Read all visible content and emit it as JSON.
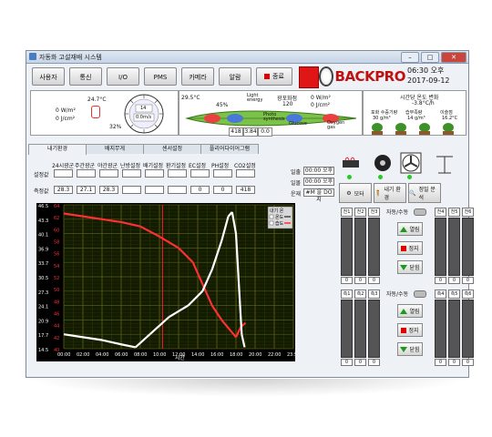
{
  "window": {
    "title": "자동화 고설재배 시스템"
  },
  "toolbar": {
    "buttons": [
      "사용자",
      "통신",
      "I/O",
      "PMS",
      "카메라",
      "알람"
    ],
    "end_label": "종료"
  },
  "logo": {
    "text": "BACKPRO"
  },
  "clock": {
    "time": "06:30 오후",
    "date": "2017-09-12"
  },
  "weather": {
    "temp": "24.7°C",
    "solar": "0 W/m²",
    "energy": "0 J/cm²",
    "wind_dir": "14",
    "wind_speed": "0.0m/s",
    "humidity": "32%"
  },
  "photo": {
    "temp": "29.5°C",
    "humidity": "45%",
    "light_label": "Light energy",
    "solar_label": "광포화점",
    "solar_value": "120",
    "solar_unit1": "0 W/m²",
    "solar_unit2": "0 J/cm²",
    "co2": "418",
    "vpd": "3.84",
    "extra": "0.0",
    "co2_unit": "ppm",
    "unit2": "Kg",
    "unit3": "°C",
    "photo_label": "Photo synthesis",
    "glucose": "Glucose",
    "oxygen": "Oxygen gas"
  },
  "plant": {
    "title": "시간당 온도 변화",
    "delta": "-3.8°C/h",
    "labels": [
      "포화 수증기량",
      "습부족량",
      "이슬점"
    ],
    "values": [
      "30 g/m³",
      "14 g/m³",
      "16.2°C"
    ]
  },
  "tabs": [
    "내기환경",
    "배지무게",
    "센서설정",
    "플리어다이어그램"
  ],
  "settings": {
    "headers": [
      "24시광군",
      "주간광군",
      "야간광군",
      "난방설정",
      "배기설정",
      "환기설정",
      "EC설정",
      "PH설정",
      "CO2설정"
    ],
    "row1_label": "설정값",
    "row2_label": "측정값",
    "measured": [
      "28.3",
      "27.1",
      "28.3",
      "",
      "",
      "",
      "0",
      "0",
      "418"
    ]
  },
  "day": {
    "labels": [
      "일출",
      "일몰",
      "운재"
    ],
    "values": [
      "00:00 오후",
      "00:00 오후",
      "#M 을 DO 지"
    ]
  },
  "icons_row": {
    "motor_label": "모터",
    "inner_label": "내기 환경",
    "analysis_label": "정밀 분석"
  },
  "chart_data": {
    "type": "line",
    "xlabel": "시간",
    "x_ticks": [
      "00:00",
      "02:00",
      "04:00",
      "06:00",
      "08:00",
      "10:00",
      "12:00",
      "14:00",
      "16:00",
      "18:00",
      "20:00",
      "22:00",
      "23:59"
    ],
    "yleft_ticks": [
      "14.5",
      "17.7",
      "20.9",
      "24.1",
      "27.3",
      "30.5",
      "33.7",
      "36.9",
      "40.1",
      "43.3",
      "46.5"
    ],
    "yright_ticks": [
      "64",
      "62",
      "60",
      "58",
      "56",
      "54",
      "52",
      "50",
      "48",
      "46",
      "44",
      "42",
      "40"
    ],
    "legend_title": "내기 온",
    "series": [
      {
        "name": "온도",
        "color": "#ffffff"
      },
      {
        "name": "습도",
        "color": "#ff3030"
      }
    ],
    "ylim_left": [
      14.5,
      46.5
    ],
    "ylim_right": [
      40,
      64
    ]
  },
  "right": {
    "auto_labels": [
      "자동/수동",
      "자동/수동"
    ],
    "open": "열림",
    "stop": "정지",
    "close": "닫힘",
    "top_cols": [
      "천1",
      "천2",
      "천3",
      "천4",
      "천5",
      "천6"
    ],
    "bottom_cols": [
      "측1",
      "측2",
      "측3",
      "측4",
      "측5",
      "측6"
    ],
    "zero": "0"
  }
}
